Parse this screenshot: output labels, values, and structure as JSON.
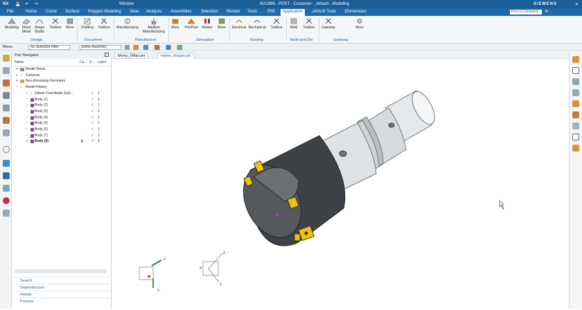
{
  "titlebar": {
    "app": "NX",
    "window_menu": "Window",
    "title": "NX1996 - POST - Customer: _default - Modeling",
    "brand": "SIEMENS"
  },
  "tabs": [
    "File",
    "Home",
    "Curve",
    "Surface",
    "Polygon Modeling",
    "View",
    "Analysis",
    "Assemblies",
    "Selection",
    "Render",
    "Tools",
    "PMI",
    "Application",
    "JANUS Tools",
    "3Dimension"
  ],
  "active_tab": "Application",
  "find_command_placeholder": "Find a Command",
  "ribbon": {
    "buttons": [
      {
        "label": "Modeling"
      },
      {
        "label": "Sheet Metal"
      },
      {
        "label": "Shape Studio"
      },
      {
        "label": "Toolbox"
      },
      {
        "label": "More"
      },
      {
        "label": "Drafting"
      },
      {
        "label": "Toolbox"
      },
      {
        "label": "Manufacturing"
      },
      {
        "label": "Additive Manufacturing"
      },
      {
        "label": "More"
      },
      {
        "label": "Pre/Post"
      },
      {
        "label": "Motion"
      },
      {
        "label": "More"
      },
      {
        "label": "Electrical"
      },
      {
        "label": "Mechanical"
      },
      {
        "label": "Toolbox"
      },
      {
        "label": "Mold"
      },
      {
        "label": "Toolbox"
      },
      {
        "label": "Gateway"
      },
      {
        "label": "More"
      }
    ],
    "groups": [
      "Design",
      "Document",
      "Manufacture",
      "Simulation",
      "Routing",
      "Mold and Die",
      "Gateway"
    ]
  },
  "selbar": {
    "menu": "Menu",
    "filter": "No Selection Filter",
    "scope": "Entire Assembly"
  },
  "navigator": {
    "title": "Part Navigator",
    "columns": [
      "Name",
      "Cu...",
      "U...",
      "Layer"
    ],
    "rows": [
      {
        "name": "Model Views",
        "check": "",
        "layer": ""
      },
      {
        "name": "Cameras",
        "check": "",
        "layer": ""
      },
      {
        "name": "Non-timestamp Geometry",
        "check": "",
        "layer": ""
      },
      {
        "name": "Model History",
        "check": "✓",
        "layer": ""
      },
      {
        "name": "Datum Coordinate Syst...",
        "check": "✓",
        "layer": "1"
      },
      {
        "name": "Body (1)",
        "check": "✓",
        "layer": "1"
      },
      {
        "name": "Body (2)",
        "check": "✓",
        "layer": "1"
      },
      {
        "name": "Body (3)",
        "check": "✓",
        "layer": "1"
      },
      {
        "name": "Body (4)",
        "check": "✓",
        "layer": "1"
      },
      {
        "name": "Body (5)",
        "check": "✓",
        "layer": "1"
      },
      {
        "name": "Body (6)",
        "check": "✓",
        "layer": "1"
      },
      {
        "name": "Body (7)",
        "check": "✓",
        "layer": "1"
      },
      {
        "name": "Body (8)",
        "check": "✓",
        "layer": "1"
      }
    ],
    "bottom": [
      "Search",
      "Dependencies",
      "Details",
      "Preview"
    ]
  },
  "doc_tabs": [
    "Merry_XMas.prt",
    "Halter_shapes.prt"
  ],
  "active_doc_tab": "Halter_shapes.prt",
  "triad_labels": {
    "x": "X",
    "y": "Y",
    "z": "Z"
  },
  "colors": {
    "title_blue": "#1a5e96",
    "tab_blue": "#1f6aa8",
    "accent_yellow": "#f2c400",
    "check_green": "#2a9d3a"
  }
}
